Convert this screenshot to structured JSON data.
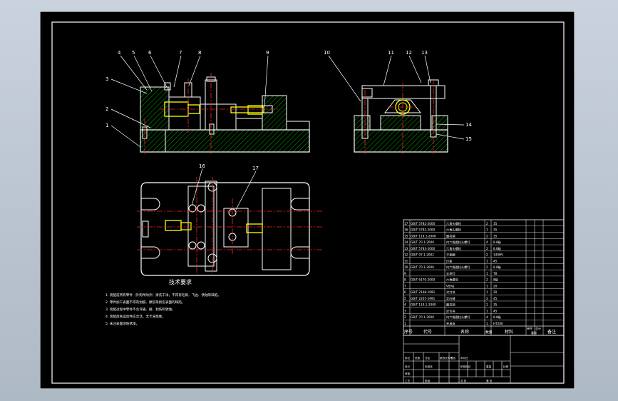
{
  "colors": {
    "background": "#000000",
    "outline": "#ffffff",
    "hatch": "#00c000",
    "centerline": "#ff2020",
    "yellow_part": "#ffff00",
    "leader": "#ffffff",
    "screen": "#b8c3cf"
  },
  "callouts": [
    "1",
    "2",
    "3",
    "4",
    "5",
    "6",
    "7",
    "8",
    "9",
    "10",
    "11",
    "12",
    "13",
    "14",
    "15",
    "16",
    "17"
  ],
  "tech_req": {
    "title": "技术要求",
    "lines": [
      "1. 装配前所有零件（外购件除外）清洗干净，不得有毛刺、飞边、锈蚀等缺陷。",
      "2. 零件加工表面不得有划痕、擦伤等损伤表面的缺陷。",
      "3. 装配过程中零件不允许磕、碰、划伤和锈蚀。",
      "4. 装配后各运动件应灵活，无卡滞现象。",
      "5. 未注表面涂防锈漆。"
    ]
  },
  "bom": {
    "rows": [
      {
        "no": "17",
        "code": "GB/T 5782-2000",
        "name": "六角头螺栓",
        "qty": "2",
        "mat": "35"
      },
      {
        "no": "16",
        "code": "GB/T 5782-2000",
        "name": "六角头螺栓",
        "qty": "1",
        "mat": "35"
      },
      {
        "no": "15",
        "code": "GB/T 119.1-2000",
        "name": "圆柱销",
        "qty": "2",
        "mat": "35"
      },
      {
        "no": "14",
        "code": "GB/T 70.1-2000",
        "name": "内六角圆柱头螺钉",
        "qty": "4",
        "mat": "8.8级"
      },
      {
        "no": "13",
        "code": "GB/T 5783-2000",
        "name": "六角头螺栓",
        "qty": "2",
        "mat": "8.8级"
      },
      {
        "no": "12",
        "code": "GB/T 97.1-2002",
        "name": "平垫圈",
        "qty": "2",
        "mat": "140HV"
      },
      {
        "no": "11",
        "code": "",
        "name": "压板",
        "qty": "1",
        "mat": "45"
      },
      {
        "no": "10",
        "code": "GB/T 70.1-2000",
        "name": "内六角圆柱头螺钉",
        "qty": "2",
        "mat": "8.8级"
      },
      {
        "no": "9",
        "code": "",
        "name": "支承钉",
        "qty": "1",
        "mat": "T8"
      },
      {
        "no": "8",
        "code": "GB/T 6170-2000",
        "name": "六角螺母",
        "qty": "2",
        "mat": "8级"
      },
      {
        "no": "7",
        "code": "",
        "name": "V形块",
        "qty": "1",
        "mat": "20"
      },
      {
        "no": "6",
        "code": "GB/T 2148-1991",
        "name": "对刀块",
        "qty": "1",
        "mat": "20"
      },
      {
        "no": "5",
        "code": "GB/T 2207-1991",
        "name": "定向键",
        "qty": "2",
        "mat": "45"
      },
      {
        "no": "4",
        "code": "GB/T 119.1-2000",
        "name": "圆柱销",
        "qty": "2",
        "mat": "35"
      },
      {
        "no": "3",
        "code": "",
        "name": "定位块",
        "qty": "1",
        "mat": "45"
      },
      {
        "no": "2",
        "code": "GB/T 70.1-2000",
        "name": "内六角圆柱头螺钉",
        "qty": "4",
        "mat": "8.8级"
      },
      {
        "no": "1",
        "code": "",
        "name": "夹具体",
        "qty": "1",
        "mat": "HT200"
      }
    ],
    "header": {
      "no": "序号",
      "code": "代号",
      "name": "名称",
      "qty": "数量",
      "mat": "材料",
      "unit_w": "单件",
      "total_w": "总计",
      "weight": "重量",
      "remark": "备注"
    }
  },
  "title_block": {
    "labels": [
      "标记",
      "处数",
      "分区",
      "更改文件号",
      "签名",
      "年月日",
      "设计",
      "标准化",
      "阶段标记",
      "重量",
      "比例",
      "审核",
      "工艺",
      "批准",
      "共 张",
      "第 张"
    ]
  }
}
